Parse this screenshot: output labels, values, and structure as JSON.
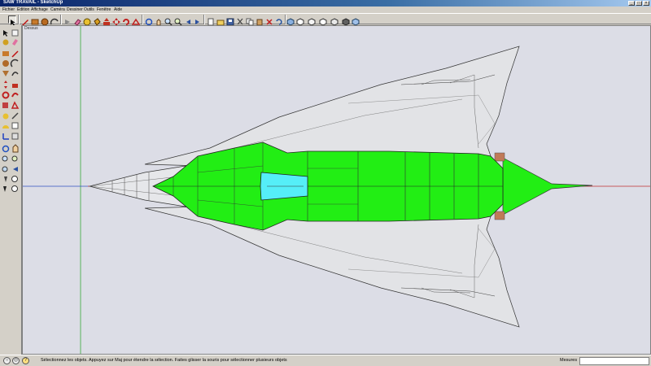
{
  "window": {
    "title": "SAW TRAVAIL - SketchUp"
  },
  "menu": [
    "Fichier",
    "Edition",
    "Affichage",
    "Caméra",
    "Dessiner",
    "Outils",
    "Fenêtre",
    "Aide"
  ],
  "viewport": {
    "scene_label": "Dessus"
  },
  "status": {
    "message": "Sélectionnez les objets. Appuyez sur Maj pour étendre la sélection. Faites glisser la souris pour sélectionner plusieurs objets",
    "measure_label": "Mesures",
    "measure_value": ""
  },
  "colors": {
    "fuselage": "#22ee14",
    "canopy": "#55eef8",
    "wing": "#e2e3e6",
    "background": "#dcdde6"
  }
}
